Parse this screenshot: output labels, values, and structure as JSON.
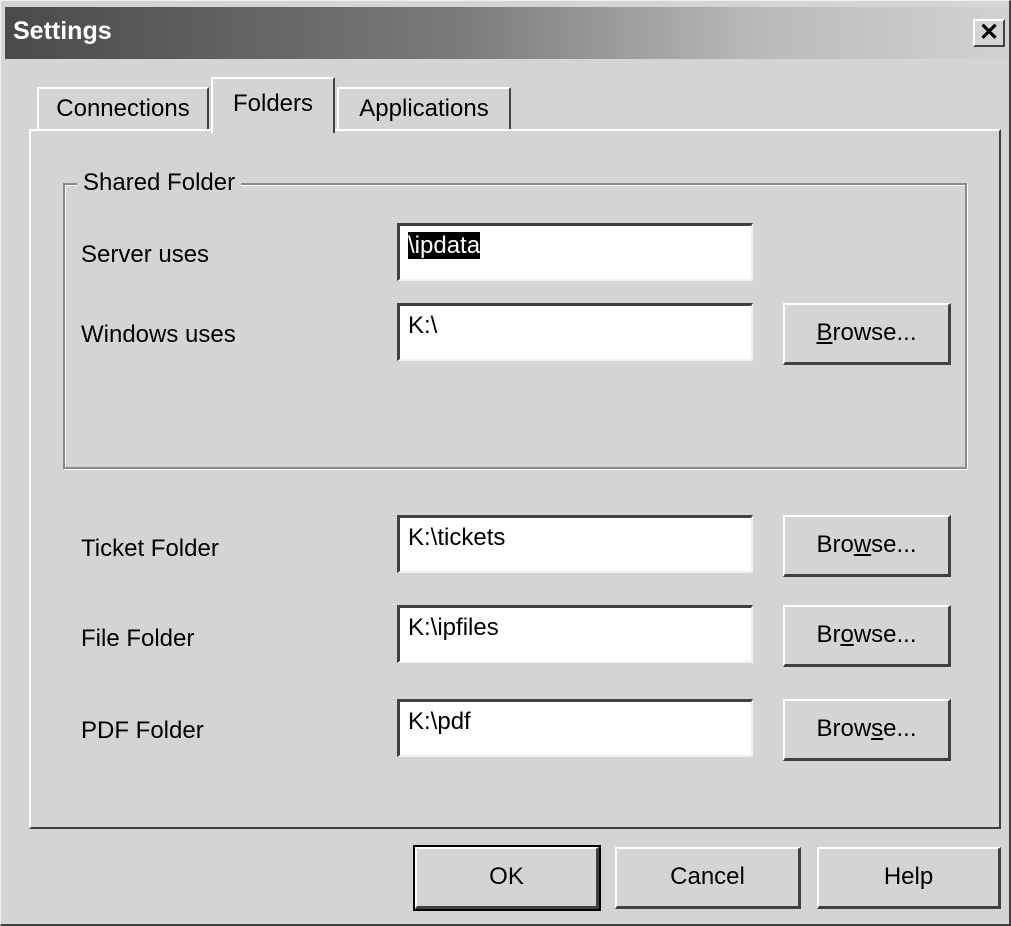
{
  "window": {
    "title": "Settings",
    "close_glyph": "✕"
  },
  "tabs": [
    {
      "label": "Connections"
    },
    {
      "label": "Folders",
      "active": true
    },
    {
      "label": "Applications"
    }
  ],
  "shared_folder": {
    "legend": "Shared Folder",
    "server_uses": {
      "label": "Server uses",
      "value": "\\ipdata"
    },
    "windows_uses": {
      "label": "Windows uses",
      "value": "K:\\"
    },
    "browse": {
      "pre": "",
      "key": "B",
      "post": "rowse..."
    }
  },
  "folders": [
    {
      "label": "Ticket Folder",
      "value": "K:\\tickets",
      "browse": {
        "pre": "Bro",
        "key": "w",
        "post": "se..."
      }
    },
    {
      "label": "File Folder",
      "value": "K:\\ipfiles",
      "browse": {
        "pre": "Br",
        "key": "o",
        "post": "wse..."
      }
    },
    {
      "label": "PDF Folder",
      "value": "K:\\pdf",
      "browse": {
        "pre": "Brow",
        "key": "s",
        "post": "e..."
      }
    }
  ],
  "buttons": {
    "ok": "OK",
    "cancel": "Cancel",
    "help": "Help"
  },
  "colors": {
    "face": "#d4d4d4",
    "title_start": "#4a4a4a",
    "title_end": "#d2d2d2"
  }
}
